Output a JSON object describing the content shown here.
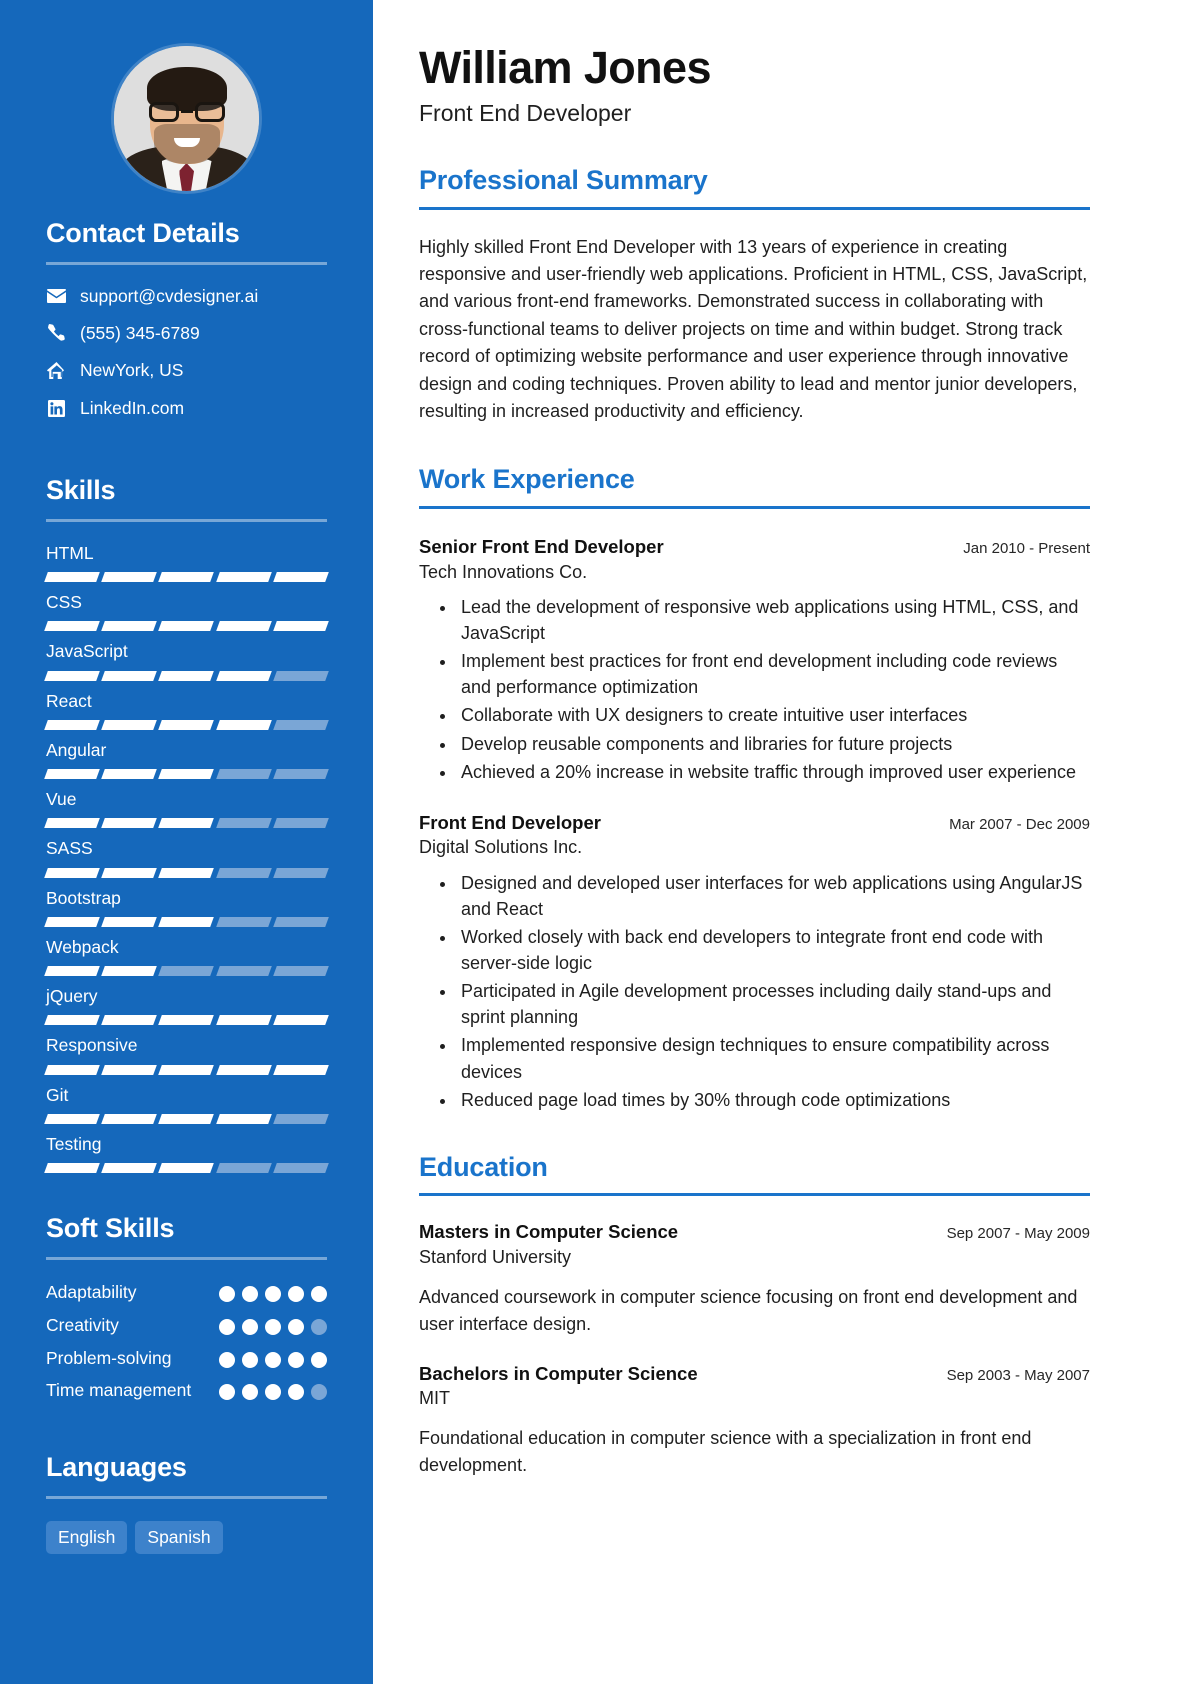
{
  "theme": {
    "sidebar_bg": "#1568bb",
    "accent": "#1a74cb",
    "segment_on": "#ffffff",
    "segment_off": "#7aa6d6",
    "tag_bg": "#3d82cb"
  },
  "header": {
    "name": "William Jones",
    "role": "Front End Developer"
  },
  "sidebar": {
    "contact": {
      "title": "Contact Details",
      "items": [
        {
          "icon": "envelope-icon",
          "value": "support@cvdesigner.ai"
        },
        {
          "icon": "phone-icon",
          "value": "(555) 345-6789"
        },
        {
          "icon": "home-icon",
          "value": "NewYork, US"
        },
        {
          "icon": "linkedin-icon",
          "value": "LinkedIn.com"
        }
      ]
    },
    "skills": {
      "title": "Skills",
      "max": 5,
      "items": [
        {
          "name": "HTML",
          "level": 5
        },
        {
          "name": "CSS",
          "level": 5
        },
        {
          "name": "JavaScript",
          "level": 4
        },
        {
          "name": "React",
          "level": 4
        },
        {
          "name": "Angular",
          "level": 3
        },
        {
          "name": "Vue",
          "level": 3
        },
        {
          "name": "SASS",
          "level": 3
        },
        {
          "name": "Bootstrap",
          "level": 3
        },
        {
          "name": "Webpack",
          "level": 2
        },
        {
          "name": "jQuery",
          "level": 5
        },
        {
          "name": "Responsive",
          "level": 5
        },
        {
          "name": "Git",
          "level": 4
        },
        {
          "name": "Testing",
          "level": 3
        }
      ]
    },
    "soft_skills": {
      "title": "Soft Skills",
      "max": 5,
      "items": [
        {
          "name": "Adaptability",
          "level": 5
        },
        {
          "name": "Creativity",
          "level": 4
        },
        {
          "name": "Problem-solving",
          "level": 5
        },
        {
          "name": "Time management",
          "level": 4
        }
      ]
    },
    "languages": {
      "title": "Languages",
      "items": [
        "English",
        "Spanish"
      ]
    }
  },
  "main": {
    "summary": {
      "title": "Professional Summary",
      "text": "Highly skilled Front End Developer with 13 years of experience in creating responsive and user-friendly web applications. Proficient in HTML, CSS, JavaScript, and various front-end frameworks. Demonstrated success in collaborating with cross-functional teams to deliver projects on time and within budget. Strong track record of optimizing website performance and user experience through innovative design and coding techniques. Proven ability to lead and mentor junior developers, resulting in increased productivity and efficiency."
    },
    "work": {
      "title": "Work Experience",
      "entries": [
        {
          "title": "Senior Front End Developer",
          "org": "Tech Innovations Co.",
          "date": "Jan 2010 - Present",
          "bullets": [
            "Lead the development of responsive web applications using HTML, CSS, and JavaScript",
            "Implement best practices for front end development including code reviews and performance optimization",
            "Collaborate with UX designers to create intuitive user interfaces",
            "Develop reusable components and libraries for future projects",
            "Achieved a 20% increase in website traffic through improved user experience"
          ]
        },
        {
          "title": "Front End Developer",
          "org": "Digital Solutions Inc.",
          "date": "Mar 2007 - Dec 2009",
          "bullets": [
            "Designed and developed user interfaces for web applications using AngularJS and React",
            "Worked closely with back end developers to integrate front end code with server-side logic",
            "Participated in Agile development processes including daily stand-ups and sprint planning",
            "Implemented responsive design techniques to ensure compatibility across devices",
            "Reduced page load times by 30% through code optimizations"
          ]
        }
      ]
    },
    "education": {
      "title": "Education",
      "entries": [
        {
          "title": "Masters in Computer Science",
          "org": "Stanford University",
          "date": "Sep 2007 - May 2009",
          "desc": "Advanced coursework in computer science focusing on front end development and user interface design."
        },
        {
          "title": "Bachelors in Computer Science",
          "org": "MIT",
          "date": "Sep 2003 - May 2007",
          "desc": "Foundational education in computer science with a specialization in front end development."
        }
      ]
    }
  }
}
